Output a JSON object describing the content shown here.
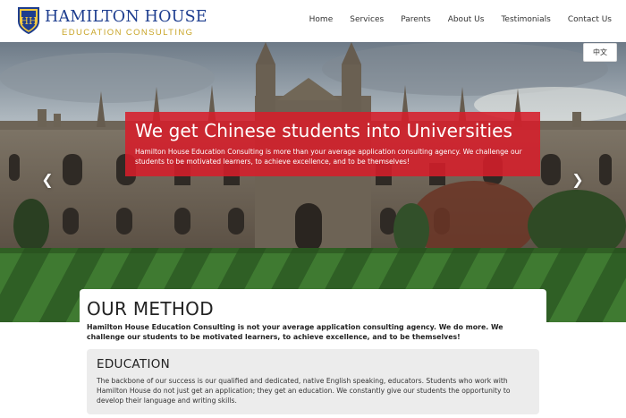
{
  "brand": {
    "name": "HAMILTON HOUSE",
    "subtitle": "EDUCATION CONSULTING",
    "crest_letters": "HH",
    "colors": {
      "navy": "#1d3d8f",
      "gold": "#c9a528"
    }
  },
  "nav": {
    "items": [
      "Home",
      "Services",
      "Parents",
      "About Us",
      "Testimonials",
      "Contact Us"
    ]
  },
  "language_toggle": "中文",
  "hero": {
    "title": "We get Chinese students into Universities",
    "text": "Hamilton House Education Consulting is more than your average application consulting agency. We challenge our students to be motivated learners, to achieve excellence, and to be themselves!",
    "prev_icon": "chevron-left-icon",
    "next_icon": "chevron-right-icon",
    "prev_glyph": "❮",
    "next_glyph": "❯",
    "caption_color": "#d61e2a"
  },
  "method": {
    "title": "OUR METHOD",
    "lead": "Hamilton House Education Consulting is not your average application consulting agency. We do more. We challenge our students to be motivated learners, to achieve excellence, and to be themselves!"
  },
  "education": {
    "title": "EDUCATION",
    "text": "The backbone of our success is our qualified and dedicated, native English speaking, educators. Students who work with Hamilton House do not just get an application; they get an education. We constantly give our students the opportunity to develop their language and writing skills."
  }
}
